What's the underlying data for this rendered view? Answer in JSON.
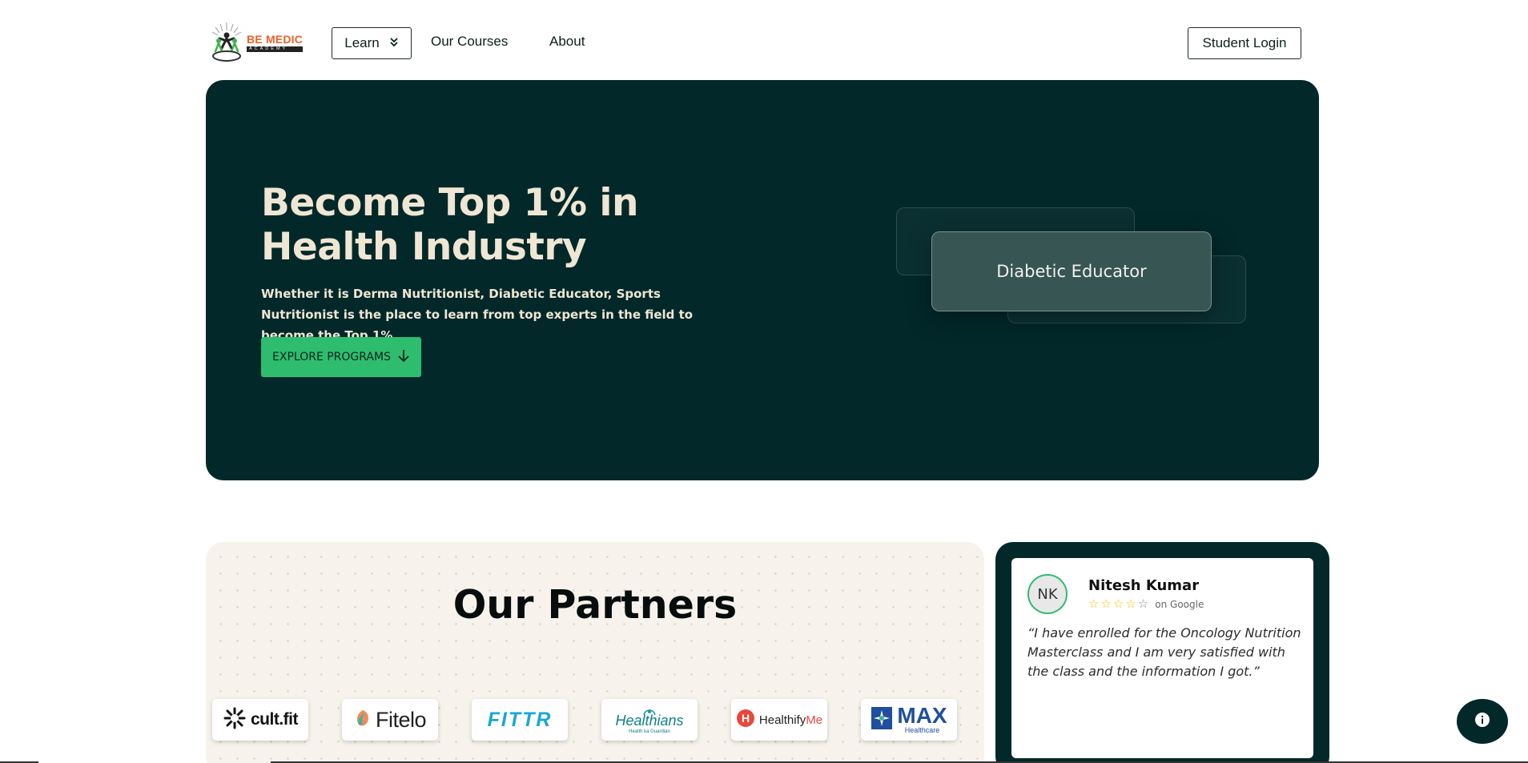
{
  "header": {
    "logo": {
      "title": "BE MEDIC",
      "subtitle": "ACADEMY"
    },
    "nav": {
      "learn_label": "Learn",
      "courses_label": "Our Courses",
      "about_label": "About"
    },
    "student_login_label": "Student Login"
  },
  "hero": {
    "title_line1": "Become Top 1% in",
    "title_line2": "Health Industry",
    "subtitle": "Whether it is Derma Nutritionist, Diabetic Educator, Sports Nutritionist is the place to learn from top experts in the field to become the Top 1%",
    "cta_label": "EXPLORE PROGRAMS",
    "card_label": "Diabetic Educator",
    "colors": {
      "background": "#02282a",
      "text": "#efe6d3",
      "cta": "#2ebd6e"
    }
  },
  "partners": {
    "title": "Our Partners",
    "logos": [
      {
        "name": "cult.fit",
        "icon": "cultfit-logo-icon"
      },
      {
        "name": "Fitelo",
        "icon": "fitelo-logo-icon"
      },
      {
        "name": "FITTR",
        "icon": "fittr-logo-icon"
      },
      {
        "name": "Healthians",
        "tagline": "Health ka Guardian",
        "icon": "healthians-logo-icon"
      },
      {
        "name_part1": "Healthify",
        "name_part2": "Me",
        "icon": "healthifyme-logo-icon"
      },
      {
        "name": "MAX",
        "sub": "Healthcare",
        "icon": "max-healthcare-logo-icon"
      }
    ]
  },
  "review": {
    "initials": "NK",
    "name": "Nitesh Kumar",
    "rating": 4,
    "rating_max": 5,
    "source": "on Google",
    "text": "“I have enrolled for the Oncology Nutrition Masterclass and I am very satisfied with the class and the information I got.”"
  }
}
